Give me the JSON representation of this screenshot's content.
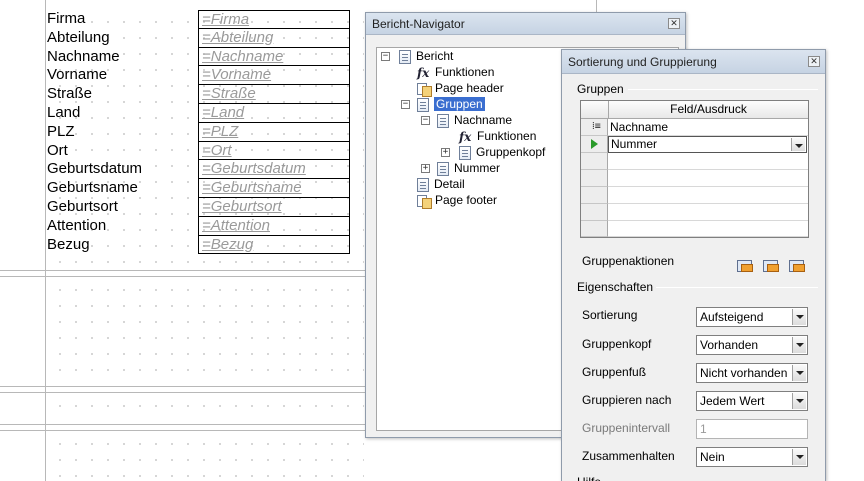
{
  "report": {
    "labels": [
      "Firma",
      "Abteilung",
      "Nachname",
      "Vorname",
      "Straße",
      "Land",
      "PLZ",
      "Ort",
      "Geburtsdatum",
      "Geburtsname",
      "Geburtsort",
      "Attention",
      "Bezug"
    ],
    "fields": [
      "=Firma",
      "=Abteilung",
      "=Nachname",
      "=Vorname",
      "=Straße",
      "=Land",
      "=PLZ",
      "=Ort",
      "=Geburtsdatum",
      "=Geburtsname",
      "=Geburtsort",
      "=Attention",
      "=Bezug"
    ]
  },
  "navigator": {
    "title": "Bericht-Navigator",
    "close_icon": "close-icon",
    "tree": {
      "root": "Bericht",
      "funktionen": "Funktionen",
      "page_header": "Page header",
      "gruppen": "Gruppen",
      "group_nachname": "Nachname",
      "group_nachname_funktionen": "Funktionen",
      "group_nachname_gruppenkopf": "Gruppenkopf",
      "group_nummer": "Nummer",
      "detail": "Detail",
      "page_footer": "Page footer"
    }
  },
  "sorting": {
    "title": "Sortierung und Gruppierung",
    "groups_section": "Gruppen",
    "column_header": "Feld/Ausdruck",
    "rows": [
      "Nachname",
      "Nummer"
    ],
    "group_actions_label": "Gruppenaktionen",
    "properties_section": "Eigenschaften",
    "props": {
      "sortierung": {
        "label": "Sortierung",
        "value": "Aufsteigend"
      },
      "gruppenkopf": {
        "label": "Gruppenkopf",
        "value": "Vorhanden"
      },
      "gruppenfuss": {
        "label": "Gruppenfuß",
        "value": "Nicht vorhanden"
      },
      "gruppieren_nach": {
        "label": "Gruppieren nach",
        "value": "Jedem Wert"
      },
      "gruppenintervall": {
        "label": "Gruppenintervall",
        "value": "1"
      },
      "zusammenhalten": {
        "label": "Zusammenhalten",
        "value": "Nein"
      }
    },
    "help_cut": "Hilfe"
  },
  "colors": {
    "selection": "#3a6ed0",
    "titlebar": "#c6d3e3",
    "field_text": "#9a9a9a"
  }
}
